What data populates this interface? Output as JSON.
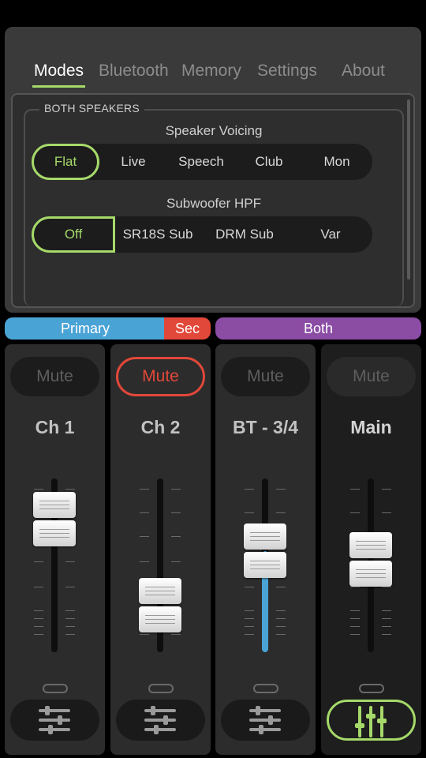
{
  "tabs": [
    {
      "label": "Modes",
      "active": true
    },
    {
      "label": "Bluetooth",
      "active": false
    },
    {
      "label": "Memory",
      "active": false
    },
    {
      "label": "Settings",
      "active": false
    },
    {
      "label": "About",
      "active": false
    }
  ],
  "speakers": {
    "group_title": "BOTH SPEAKERS",
    "voicing": {
      "label": "Speaker Voicing",
      "options": [
        "Flat",
        "Live",
        "Speech",
        "Club",
        "Mon"
      ],
      "selected": "Flat"
    },
    "hpf": {
      "label": "Subwoofer HPF",
      "options": [
        "Off",
        "SR18S Sub",
        "DRM Sub",
        "Var"
      ],
      "selected": "Off"
    }
  },
  "mode_bar": {
    "primary_label": "Primary",
    "sec_label": "Sec",
    "both_label": "Both"
  },
  "channels": [
    {
      "name": "Ch 1",
      "mute_label": "Mute",
      "muted": false,
      "fader_level": 0.92
    },
    {
      "name": "Ch 2",
      "mute_label": "Mute",
      "muted": true,
      "fader_level": 0.24
    },
    {
      "name": "BT - 3/4",
      "mute_label": "Mute",
      "muted": false,
      "fader_level": 0.67
    },
    {
      "name": "Main",
      "mute_label": "Mute",
      "muted": false,
      "fader_level": 0.6
    }
  ],
  "colors": {
    "accent_green": "#a6d96a",
    "primary_blue": "#4aa3d5",
    "sec_red": "#e2483a",
    "both_purple": "#8b4ca4"
  },
  "icons": {
    "eq_settings": "sliders-icon",
    "main_settings": "vertical-sliders-icon"
  }
}
